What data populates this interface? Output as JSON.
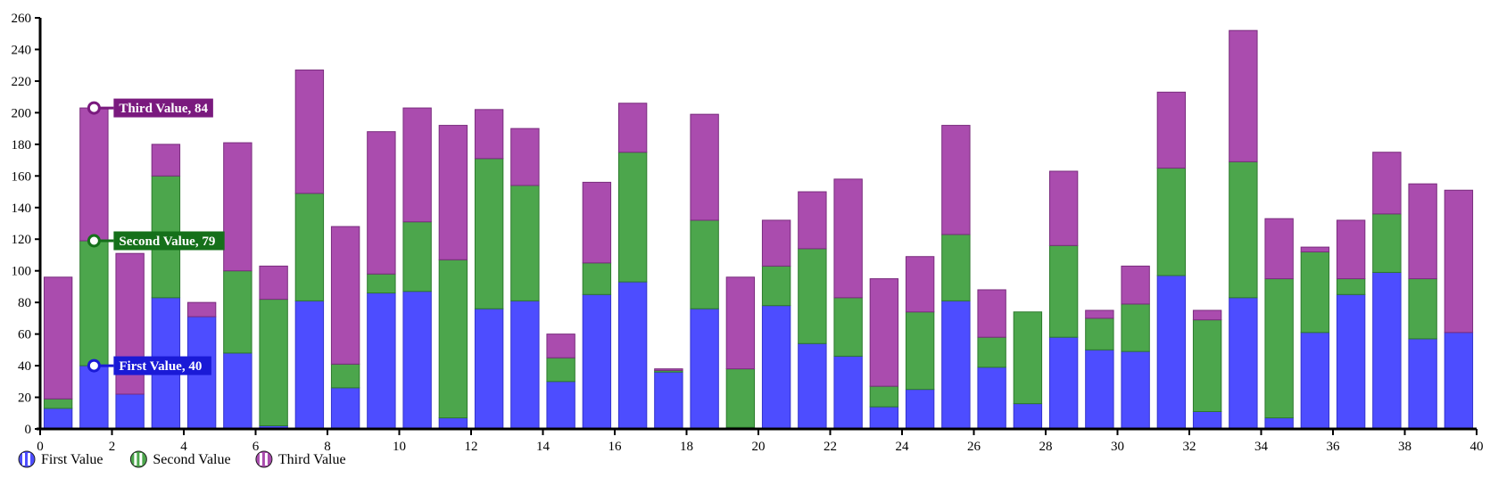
{
  "chart_data": {
    "type": "bar",
    "stacked": true,
    "title": "",
    "xlabel": "",
    "ylabel": "",
    "xlim": [
      0,
      40
    ],
    "ylim": [
      0,
      260
    ],
    "ytick_step": 20,
    "xtick_step": 2,
    "grid": false,
    "legend_position": "bottom",
    "categories": [
      0,
      1,
      2,
      3,
      4,
      5,
      6,
      7,
      8,
      9,
      10,
      11,
      12,
      13,
      14,
      15,
      16,
      17,
      18,
      19,
      20,
      21,
      22,
      23,
      24,
      25,
      26,
      27,
      28,
      29,
      30,
      31,
      32,
      33,
      34,
      35,
      36,
      37,
      38,
      39
    ],
    "ytick_labels": [
      "0",
      "20",
      "40",
      "60",
      "80",
      "100",
      "120",
      "140",
      "160",
      "180",
      "200",
      "220",
      "240",
      "260"
    ],
    "xtick_labels": [
      "0",
      "2",
      "4",
      "6",
      "8",
      "10",
      "12",
      "14",
      "16",
      "18",
      "20",
      "22",
      "24",
      "26",
      "28",
      "30",
      "32",
      "34",
      "36",
      "38",
      "40"
    ],
    "series": [
      {
        "name": "First Value",
        "color": "#4d4dff",
        "stroke": "#3333cc",
        "values": [
          13,
          40,
          22,
          83,
          71,
          48,
          2,
          81,
          26,
          86,
          87,
          7,
          76,
          81,
          30,
          85,
          93,
          36,
          76,
          1,
          78,
          54,
          46,
          14,
          25,
          81,
          39,
          16,
          58,
          50,
          49,
          97,
          11,
          83,
          7,
          61,
          85,
          99,
          57,
          61
        ]
      },
      {
        "name": "Second Value",
        "color": "#4ca64c",
        "stroke": "#2d7a2d",
        "values": [
          6,
          79,
          0,
          77,
          0,
          52,
          80,
          68,
          15,
          12,
          44,
          100,
          95,
          73,
          15,
          20,
          82,
          1,
          56,
          37,
          25,
          60,
          37,
          13,
          49,
          42,
          19,
          58,
          58,
          20,
          30,
          68,
          58,
          86,
          88,
          51,
          10,
          37,
          38,
          0
        ]
      },
      {
        "name": "Third Value",
        "color": "#aa4cae",
        "stroke": "#7a2d7e",
        "values": [
          77,
          84,
          89,
          20,
          9,
          81,
          21,
          78,
          87,
          90,
          72,
          85,
          31,
          36,
          15,
          51,
          31,
          1,
          67,
          58,
          29,
          36,
          75,
          68,
          35,
          69,
          30,
          0,
          47,
          5,
          24,
          48,
          6,
          83,
          38,
          3,
          37,
          39,
          60,
          90
        ]
      }
    ],
    "callouts": [
      {
        "series": "Third Value",
        "label": "Third Value, 84",
        "bar_index": 1,
        "value_y": 203,
        "color": "#7a1a7e",
        "anchor_color": "#7a1a7e"
      },
      {
        "series": "Second Value",
        "label": "Second Value, 79",
        "bar_index": 1,
        "value_y": 119,
        "color": "#15701a",
        "anchor_color": "#15701a"
      },
      {
        "series": "First Value",
        "label": "First Value, 40",
        "bar_index": 1,
        "value_y": 40,
        "color": "#1a1ad6",
        "anchor_color": "#1a1ad6"
      }
    ]
  },
  "legend": {
    "items": [
      {
        "label": "First Value",
        "color": "#4d4dff",
        "icon": "circle-bar-icon"
      },
      {
        "label": "Second Value",
        "color": "#4ca64c",
        "icon": "circle-bar-icon"
      },
      {
        "label": "Third Value",
        "color": "#aa4cae",
        "icon": "circle-bar-icon"
      }
    ]
  },
  "axes": {
    "axis_color": "#000000",
    "y_axis_name": "y-axis",
    "x_axis_name": "x-axis"
  }
}
